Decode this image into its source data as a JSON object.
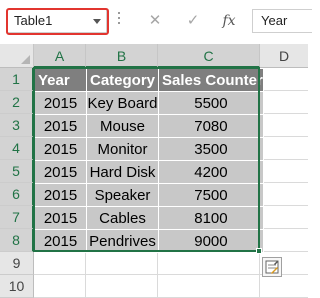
{
  "name_box": {
    "value": "Table1"
  },
  "formula_bar": {
    "cancel_glyph": "✕",
    "enter_glyph": "✓",
    "fx_label": "fx",
    "value": "Year"
  },
  "columns": [
    "A",
    "B",
    "C",
    "D"
  ],
  "rows": [
    "1",
    "2",
    "3",
    "4",
    "5",
    "6",
    "7",
    "8",
    "9",
    "10"
  ],
  "table": {
    "headers": [
      "Year",
      "Category",
      "Sales Counter"
    ],
    "rows": [
      [
        "2015",
        "Key Board",
        "5500"
      ],
      [
        "2015",
        "Mouse",
        "7080"
      ],
      [
        "2015",
        "Monitor",
        "3500"
      ],
      [
        "2015",
        "Hard Disk",
        "4200"
      ],
      [
        "2015",
        "Speaker",
        "7500"
      ],
      [
        "2015",
        "Cables",
        "8100"
      ],
      [
        "2015",
        "Pendrives",
        "9000"
      ]
    ]
  },
  "colors": {
    "accent": "#217346",
    "header_fill": "#7f7f7f",
    "row_fill": "#c8c8c8",
    "highlight": "#e2352f"
  },
  "icons": {
    "quick_analysis": "quick-analysis-icon",
    "dropdown": "chevron-down-icon"
  }
}
